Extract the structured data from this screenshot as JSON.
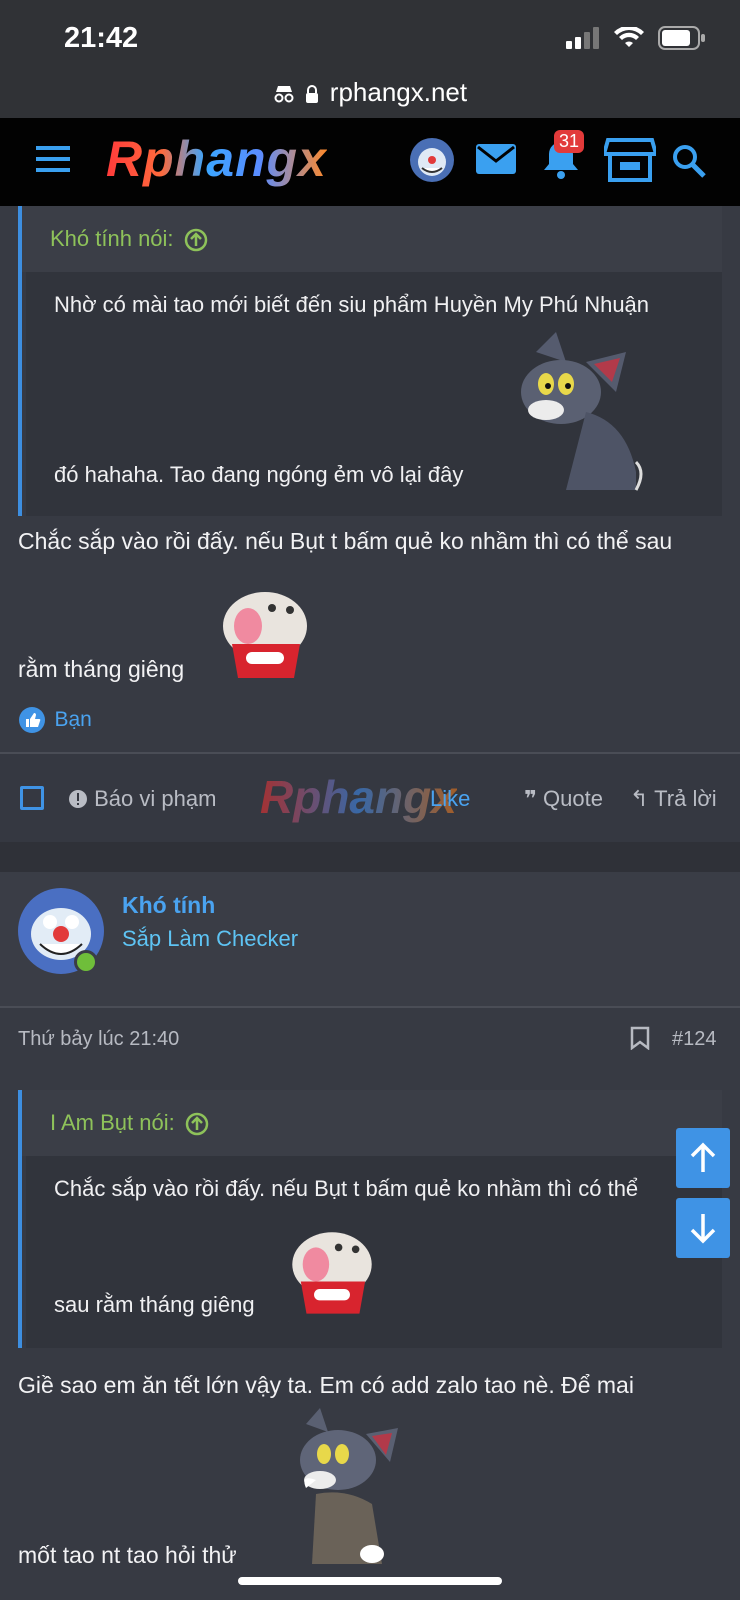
{
  "status_bar": {
    "time": "21:42"
  },
  "browser": {
    "url": "rphangx.net"
  },
  "navbar": {
    "logo": "Rphangx",
    "notification_count": "31"
  },
  "post1": {
    "quote": {
      "author_label": "Khó tính nói:",
      "line1": "Nhờ có mài tao mới biết đến siu phẩm Huyền My Phú Nhuận",
      "line2": "đó hahaha. Tao đang ngóng ẻm vô lại đây"
    },
    "body_line1": "Chắc sắp vào rồi đấy. nếu Bụt t bấm quẻ ko nhầm thì có thể sau",
    "body_line2": "rằm tháng giêng",
    "reaction_label": "Bạn",
    "actions": {
      "report": "Báo vi phạm",
      "like": "Like",
      "quote": "Quote",
      "reply": "Trả lời"
    }
  },
  "post2": {
    "username": "Khó tính",
    "user_title": "Sắp Làm Checker",
    "timestamp": "Thứ bảy lúc 21:40",
    "post_number": "#124",
    "quote": {
      "author_label": "I Am Bụt nói:",
      "line1": "Chắc sắp vào rồi đấy. nếu Bụt t bấm quẻ ko nhầm thì có thể",
      "line2": "sau rằm tháng giêng"
    },
    "body_line1": "Giề sao em ăn tết lớn vậy ta. Em có add zalo tao nè. Để mai",
    "body_line2": "mốt tao nt tao hỏi thử"
  },
  "colors": {
    "accent": "#3f93e5",
    "quote_author": "#8ec25a",
    "username": "#4aa3f0",
    "background": "#373a43"
  }
}
